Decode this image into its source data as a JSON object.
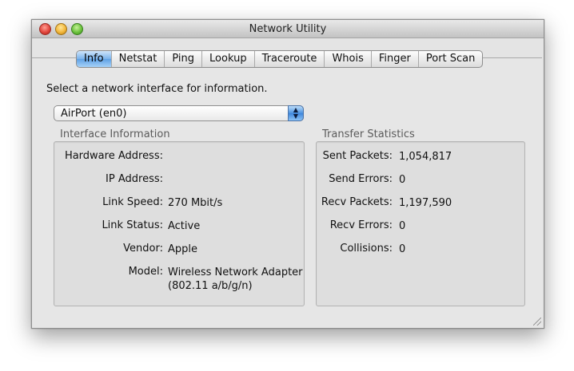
{
  "window": {
    "title": "Network Utility"
  },
  "tabs": [
    "Info",
    "Netstat",
    "Ping",
    "Lookup",
    "Traceroute",
    "Whois",
    "Finger",
    "Port Scan"
  ],
  "info": {
    "prompt": "Select a network interface for information.",
    "interface_select": {
      "value": "AirPort (en0)"
    },
    "interface_info": {
      "title": "Interface Information",
      "hardware_address_label": "Hardware Address:",
      "hardware_address": "",
      "ip_address_label": "IP Address:",
      "ip_address": "",
      "link_speed_label": "Link Speed:",
      "link_speed": "270 Mbit/s",
      "link_status_label": "Link Status:",
      "link_status": "Active",
      "vendor_label": "Vendor:",
      "vendor": "Apple",
      "model_label": "Model:",
      "model_line1": "Wireless Network Adapter",
      "model_line2": "(802.11 a/b/g/n)"
    },
    "transfer_stats": {
      "title": "Transfer Statistics",
      "sent_packets_label": "Sent Packets:",
      "sent_packets": "1,054,817",
      "send_errors_label": "Send Errors:",
      "send_errors": "0",
      "recv_packets_label": "Recv Packets:",
      "recv_packets": "1,197,590",
      "recv_errors_label": "Recv Errors:",
      "recv_errors": "0",
      "collisions_label": "Collisions:",
      "collisions": "0"
    }
  },
  "colors": {
    "active_tab": "#6aa9e8",
    "window_bg": "#e4e4e4"
  }
}
